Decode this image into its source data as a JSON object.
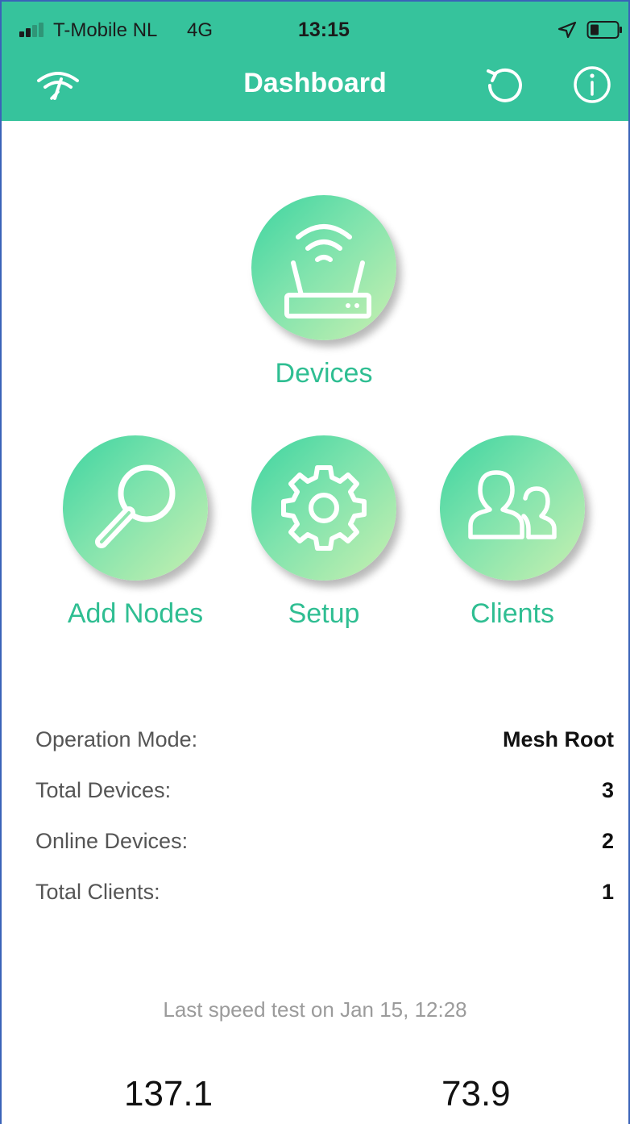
{
  "status_bar": {
    "carrier": "T-Mobile NL",
    "network": "4G",
    "time": "13:15"
  },
  "nav": {
    "title": "Dashboard",
    "left_icon": "wifi-speed-logo-icon",
    "right_icons": [
      "refresh-icon",
      "info-icon"
    ]
  },
  "tiles": {
    "devices": "Devices",
    "add_nodes": "Add Nodes",
    "setup": "Setup",
    "clients": "Clients"
  },
  "stats": [
    {
      "label": "Operation Mode:",
      "value": "Mesh Root"
    },
    {
      "label": "Total Devices:",
      "value": "3"
    },
    {
      "label": "Online Devices:",
      "value": "2"
    },
    {
      "label": "Total Clients:",
      "value": "1"
    }
  ],
  "speed_test": {
    "note": "Last speed test on Jan 15, 12:28",
    "download": "137.1",
    "upload": "73.9"
  },
  "colors": {
    "accent": "#36c39c",
    "label_green": "#2fbe92"
  }
}
